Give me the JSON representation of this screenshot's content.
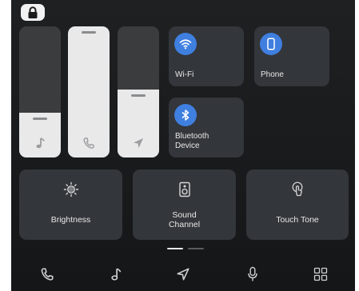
{
  "status": {
    "lock_icon": "lock-icon"
  },
  "sliders": [
    {
      "name": "media-volume",
      "icon": "music-note-icon",
      "level_percent": 34
    },
    {
      "name": "call-volume",
      "icon": "phone-icon",
      "level_percent": 100
    },
    {
      "name": "navigation-volume",
      "icon": "navigation-arrow-icon",
      "level_percent": 52
    }
  ],
  "tiles": {
    "wifi": {
      "label": "Wi-Fi",
      "icon": "wifi-icon"
    },
    "phone": {
      "label": "Phone",
      "icon": "phone-device-icon"
    },
    "bluetooth": {
      "label_line1": "Bluetooth",
      "label_line2": "Device",
      "icon": "bluetooth-icon"
    }
  },
  "bottom_tiles": {
    "brightness": {
      "label": "Brightness",
      "icon": "brightness-icon"
    },
    "sound_channel": {
      "label_line1": "Sound",
      "label_line2": "Channel",
      "icon": "speaker-icon"
    },
    "touch_tone": {
      "label": "Touch Tone",
      "icon": "touch-icon"
    }
  },
  "page_indicator": {
    "pages": 2,
    "current": 1
  },
  "nav": [
    "phone-icon",
    "music-note-icon",
    "navigation-arrow-icon",
    "microphone-icon",
    "apps-grid-icon"
  ],
  "colors": {
    "accent": "#3f7fe0",
    "tile": "#33363a",
    "background": "#1a1c1d"
  }
}
